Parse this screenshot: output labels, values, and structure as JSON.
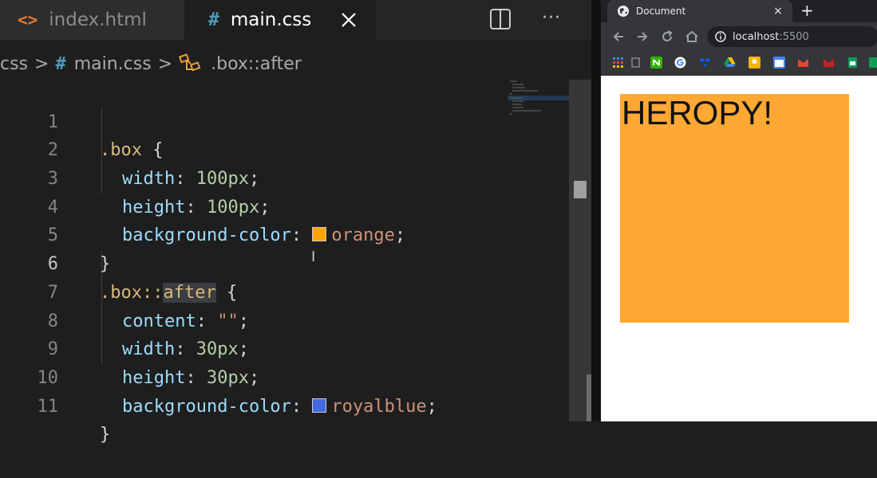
{
  "editor": {
    "tabs": [
      {
        "icon": "<>",
        "label": "index.html"
      },
      {
        "icon": "#",
        "label": "main.css"
      }
    ],
    "more_label": "···",
    "breadcrumb": {
      "folder": "css",
      "file": "main.css",
      "symbol": ".box::after",
      "separator": ">"
    },
    "line_numbers": [
      "1",
      "2",
      "3",
      "4",
      "5",
      "6",
      "7",
      "8",
      "9",
      "10",
      "11"
    ],
    "code": {
      "l1_selector": ".box",
      "l1_brace": " {",
      "l2_prop": "width",
      "l2_value": "100px",
      "l3_prop": "height",
      "l3_value": "100px",
      "l4_prop": "background-color",
      "l4_value": "orange",
      "l5_brace": "}",
      "l6_selector_a": ".box::",
      "l6_selector_b": "after",
      "l6_brace": " {",
      "l7_prop": "content",
      "l7_value": "\"\"",
      "l8_prop": "width",
      "l8_value": "30px",
      "l9_prop": "height",
      "l9_value": "30px",
      "l10_prop": "background-color",
      "l10_value": "royalblue",
      "l11_brace": "}",
      "colon": ": ",
      "semicolon": ";"
    },
    "colors": {
      "orange_swatch": "#ffa500",
      "royalblue_swatch": "#4169e1"
    }
  },
  "browser": {
    "tab_title": "Document",
    "tab_close": "×",
    "new_tab": "+",
    "url_host": "localhost",
    "url_port": ":5500",
    "page_text": "HEROPY!",
    "box_color": "#ffa834"
  }
}
